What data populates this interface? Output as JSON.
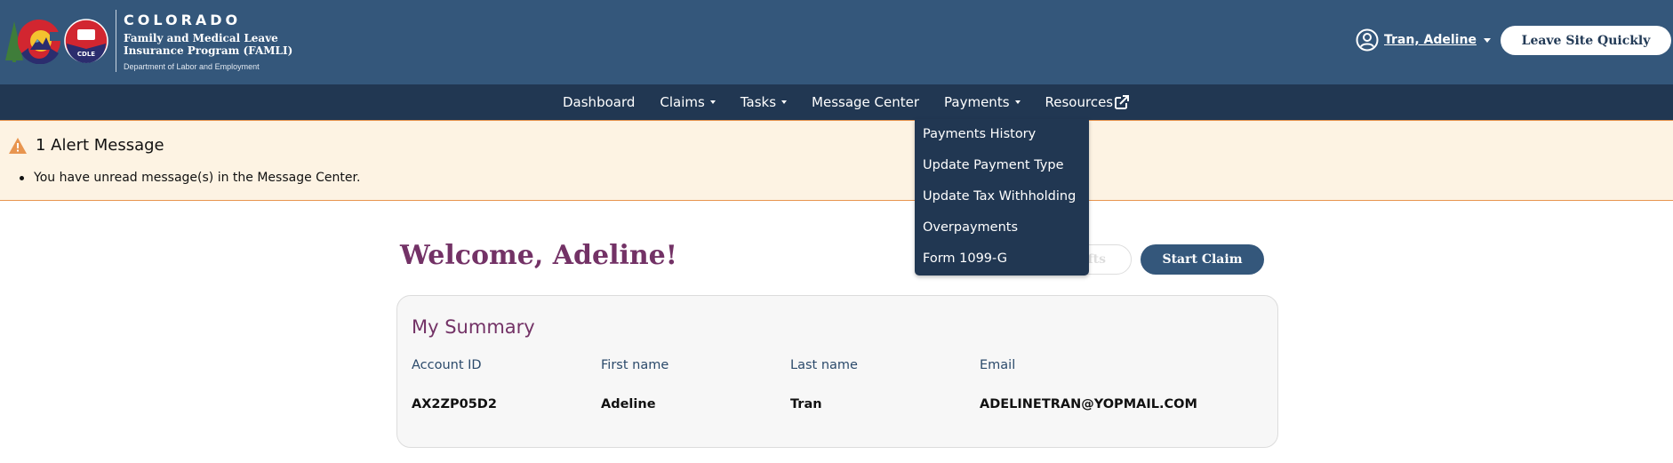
{
  "header": {
    "logo": {
      "state": "COLORADO",
      "program_line1": "Family and Medical Leave",
      "program_line2": "Insurance Program (FAMLI)",
      "department": "Department of Labor and Employment",
      "seal_label": "CDLE"
    },
    "user_menu": {
      "icon": "user-circle-icon",
      "name": "Tran, Adeline"
    },
    "leave_site_label": "Leave Site Quickly"
  },
  "nav": {
    "items": [
      {
        "label": "Dashboard",
        "has_caret": false
      },
      {
        "label": "Claims",
        "has_caret": true
      },
      {
        "label": "Tasks",
        "has_caret": true
      },
      {
        "label": "Message Center",
        "has_caret": false
      },
      {
        "label": "Payments",
        "has_caret": true
      },
      {
        "label": "Resources",
        "has_caret": false,
        "icon": "external-link-icon"
      }
    ],
    "payments_dropdown": [
      "Payments History",
      "Update Payment Type",
      "Update Tax Withholding",
      "Overpayments",
      "Form 1099-G"
    ]
  },
  "alert": {
    "icon": "warning-icon",
    "title": "1 Alert Message",
    "messages": [
      "You have unread message(s) in the Message Center."
    ],
    "colors": {
      "background": "#fdf3e3",
      "border": "#e8954f"
    }
  },
  "main": {
    "welcome": "Welcome, Adeline!",
    "drafts_button_visible_text": "fts",
    "start_claim_label": "Start Claim",
    "summary": {
      "title": "My Summary",
      "fields": [
        {
          "label": "Account ID",
          "value": "AX2ZP05D2"
        },
        {
          "label": "First name",
          "value": "Adeline"
        },
        {
          "label": "Last name",
          "value": "Tran"
        },
        {
          "label": "Email",
          "value": "ADELINETRAN@YOPMAIL.COM"
        }
      ]
    }
  },
  "colors": {
    "header": "#34577b",
    "nav": "#213752",
    "accent_purple": "#733266"
  }
}
